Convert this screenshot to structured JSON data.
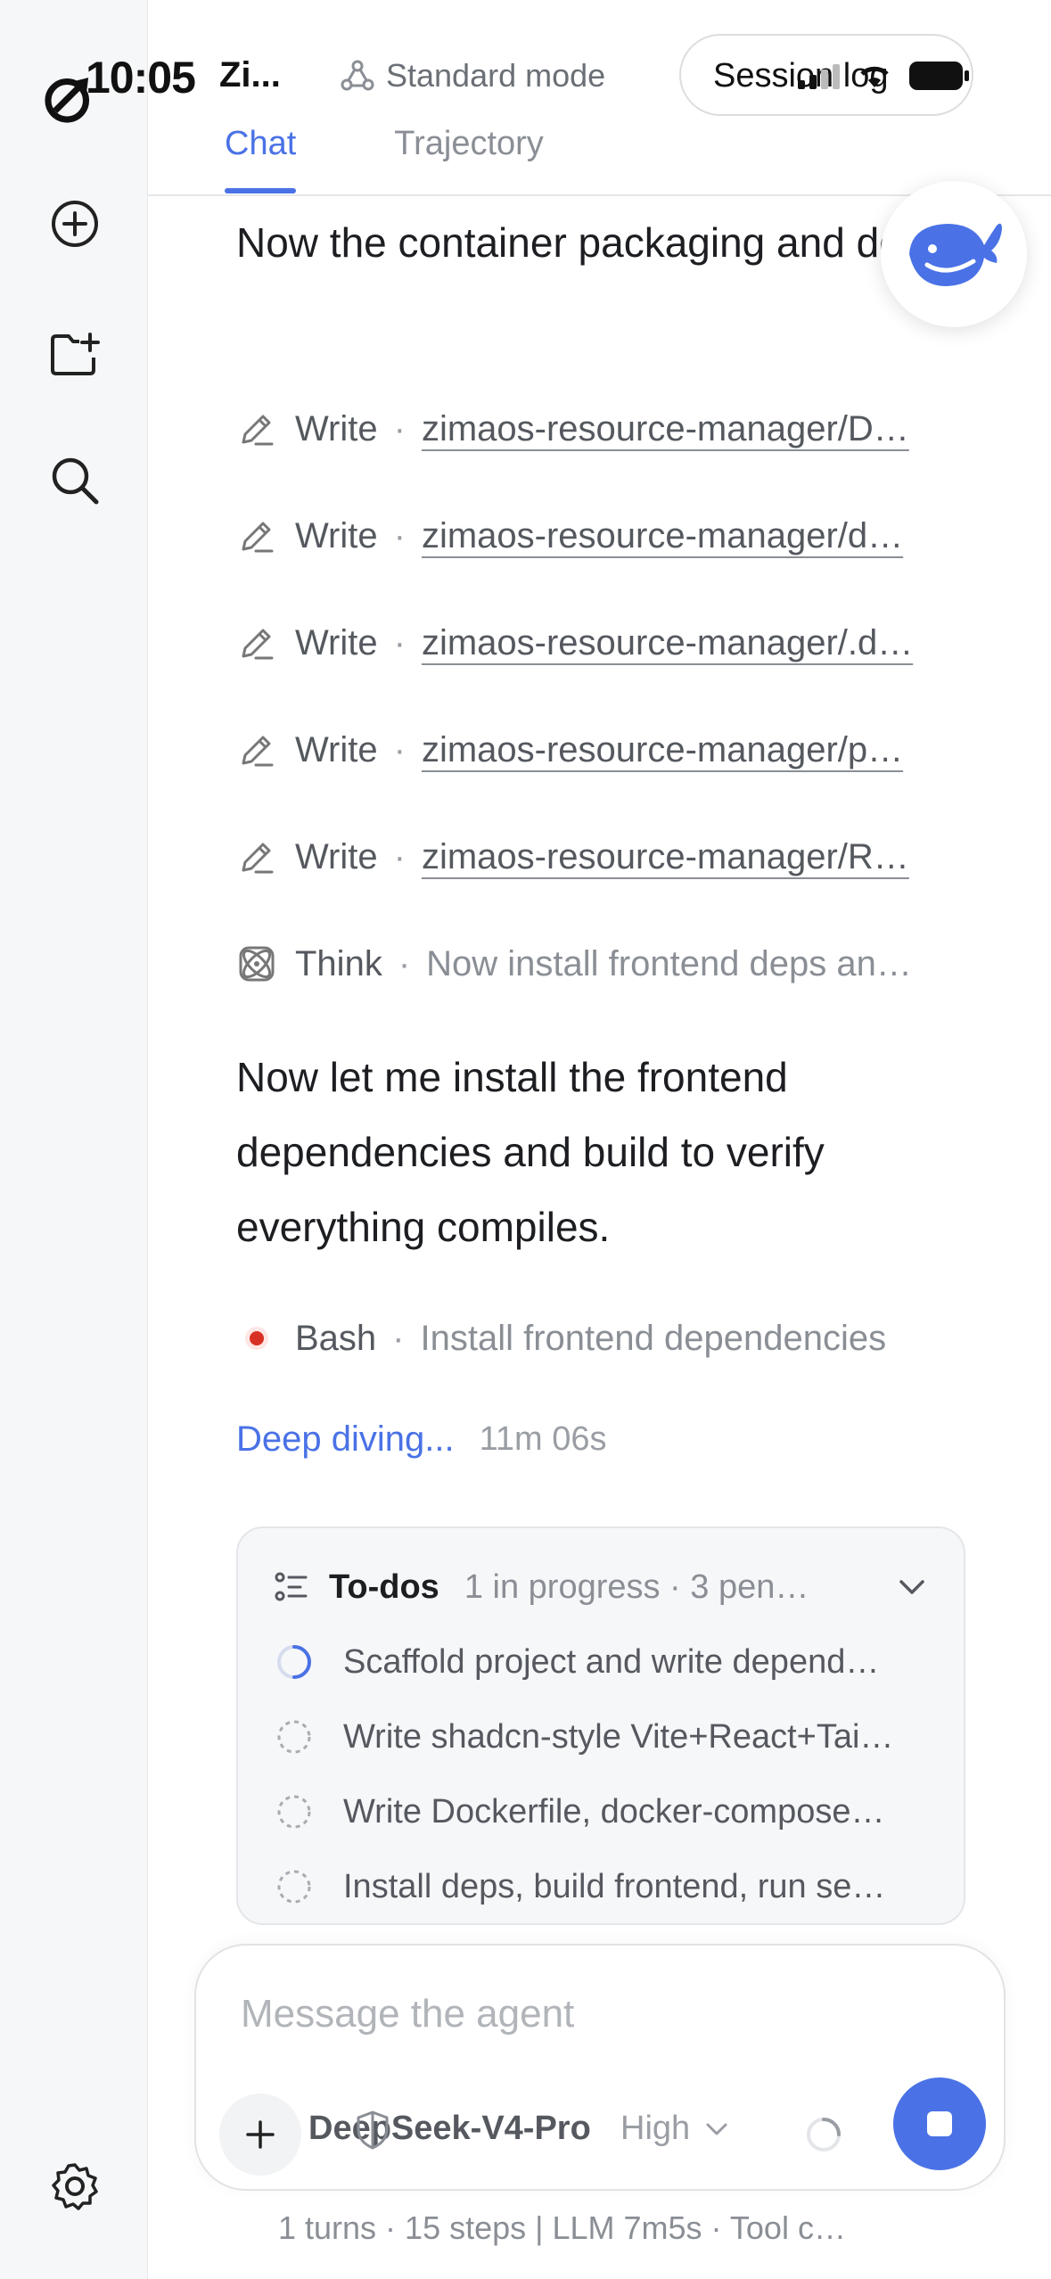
{
  "status_bar": {
    "time": "10:05"
  },
  "header": {
    "session_short": "Zi...",
    "mode_label": "Standard mode",
    "session_button": "Session log",
    "tabs": [
      {
        "label": "Chat",
        "active": true
      },
      {
        "label": "Trajectory",
        "active": false
      }
    ]
  },
  "chat": {
    "para1": "Now the container packaging and docs.",
    "steps": [
      {
        "icon": "pencil-icon",
        "verb": "Write",
        "target": "zimaos-resource-manager/D…"
      },
      {
        "icon": "pencil-icon",
        "verb": "Write",
        "target": "zimaos-resource-manager/d…"
      },
      {
        "icon": "pencil-icon",
        "verb": "Write",
        "target": "zimaos-resource-manager/.d…"
      },
      {
        "icon": "pencil-icon",
        "verb": "Write",
        "target": "zimaos-resource-manager/p…"
      },
      {
        "icon": "pencil-icon",
        "verb": "Write",
        "target": "zimaos-resource-manager/R…"
      },
      {
        "icon": "atom-icon",
        "verb": "Think",
        "target": "Now install frontend deps an…"
      }
    ],
    "para2": "Now let me install the frontend dependencies and build to verify everything compiles.",
    "bash_step": {
      "verb": "Bash",
      "target": "Install frontend dependencies"
    },
    "deep_diving": {
      "label": "Deep diving...",
      "elapsed": "11m 06s"
    }
  },
  "todos": {
    "title": "To-dos",
    "meta": "1 in progress · 3 pen…",
    "items": [
      {
        "text": "Scaffold project and write depend…",
        "status": "in_progress"
      },
      {
        "text": "Write shadcn-style Vite+React+Tai…",
        "status": "pending"
      },
      {
        "text": "Write Dockerfile, docker-compose…",
        "status": "pending"
      },
      {
        "text": "Install deps, build frontend, run se…",
        "status": "pending"
      }
    ]
  },
  "composer": {
    "placeholder": "Message the agent",
    "model": "DeepSeek-V4-Pro",
    "level": "High"
  },
  "footer": {
    "stats": "1 turns · 15 steps   |   LLM 7m5s · Tool c…"
  },
  "colors": {
    "accent": "#4a72e6",
    "running_dot": "#d93025"
  }
}
